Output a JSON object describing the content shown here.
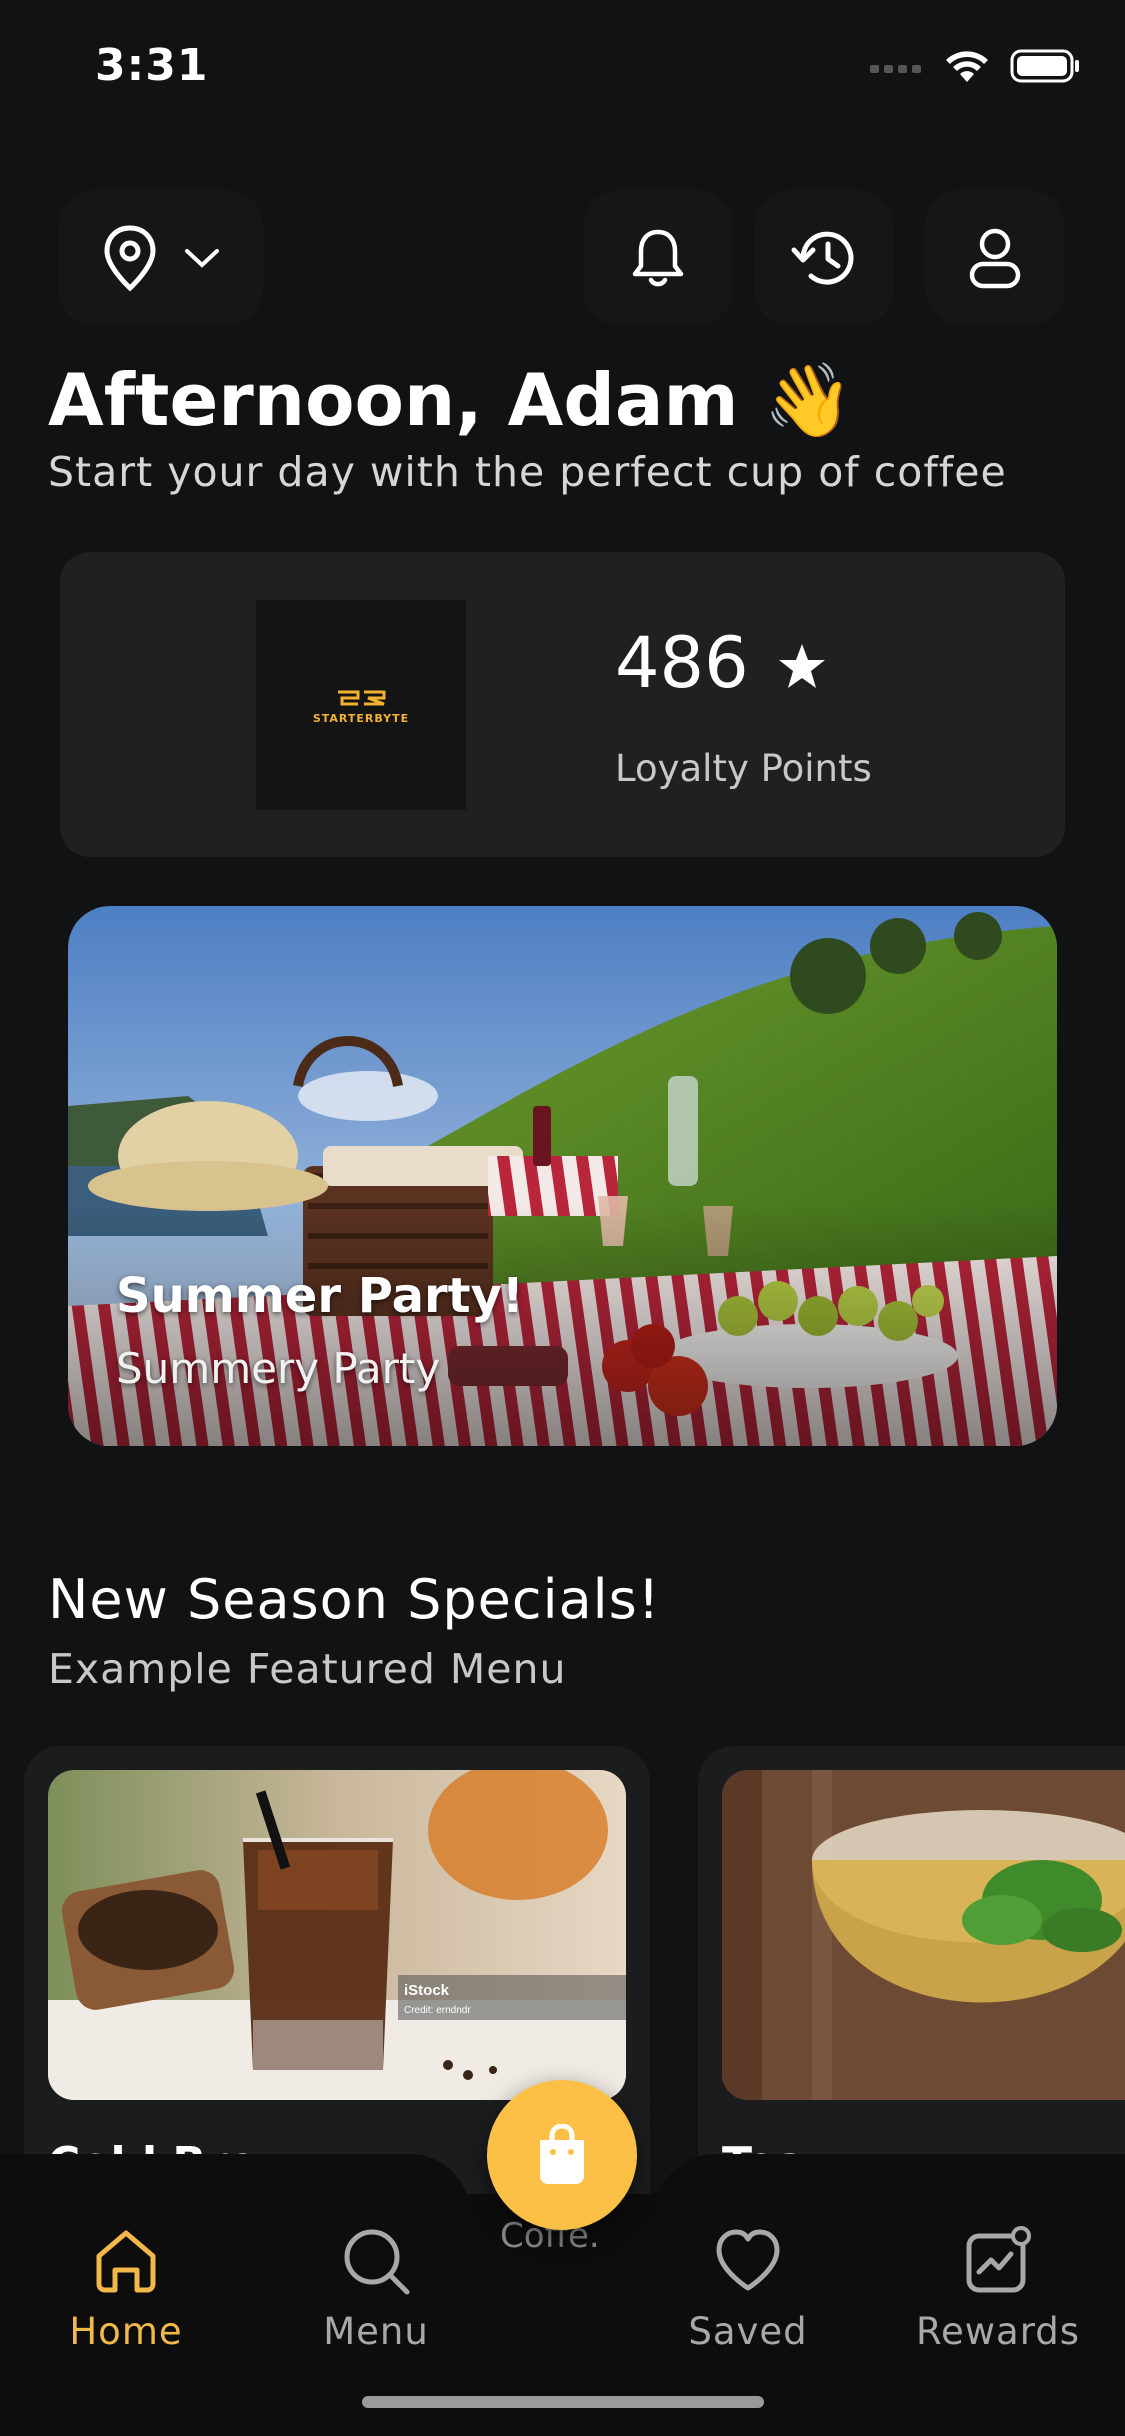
{
  "status": {
    "time": "3:31"
  },
  "header": {
    "location_icon": "location-pin-icon",
    "notifications_icon": "bell-icon",
    "history_icon": "history-icon",
    "profile_icon": "user-icon"
  },
  "greeting": {
    "title": "Afternoon, Adam 👋",
    "subtitle": "Start your day with the perfect cup of coffee"
  },
  "loyalty": {
    "logo_text": "STARTERBYTE",
    "points": "486",
    "label": "Loyalty Points"
  },
  "promo": {
    "title": "Summer Party!",
    "subtitle": "Summery Party"
  },
  "specials": {
    "title": "New Season Specials!",
    "subtitle": "Example Featured Menu",
    "items": [
      {
        "name": "Cold Brew",
        "watermark": "iStock",
        "credit": "Credit: erndndr"
      },
      {
        "name": "Tea"
      }
    ]
  },
  "nav": {
    "home": "Home",
    "menu": "Menu",
    "cart_partial": "Coffe.",
    "saved": "Saved",
    "rewards": "Rewards"
  },
  "colors": {
    "accent": "#fcc046",
    "active_nav": "#f2b94a",
    "background": "#111213",
    "card": "#1f2021"
  }
}
